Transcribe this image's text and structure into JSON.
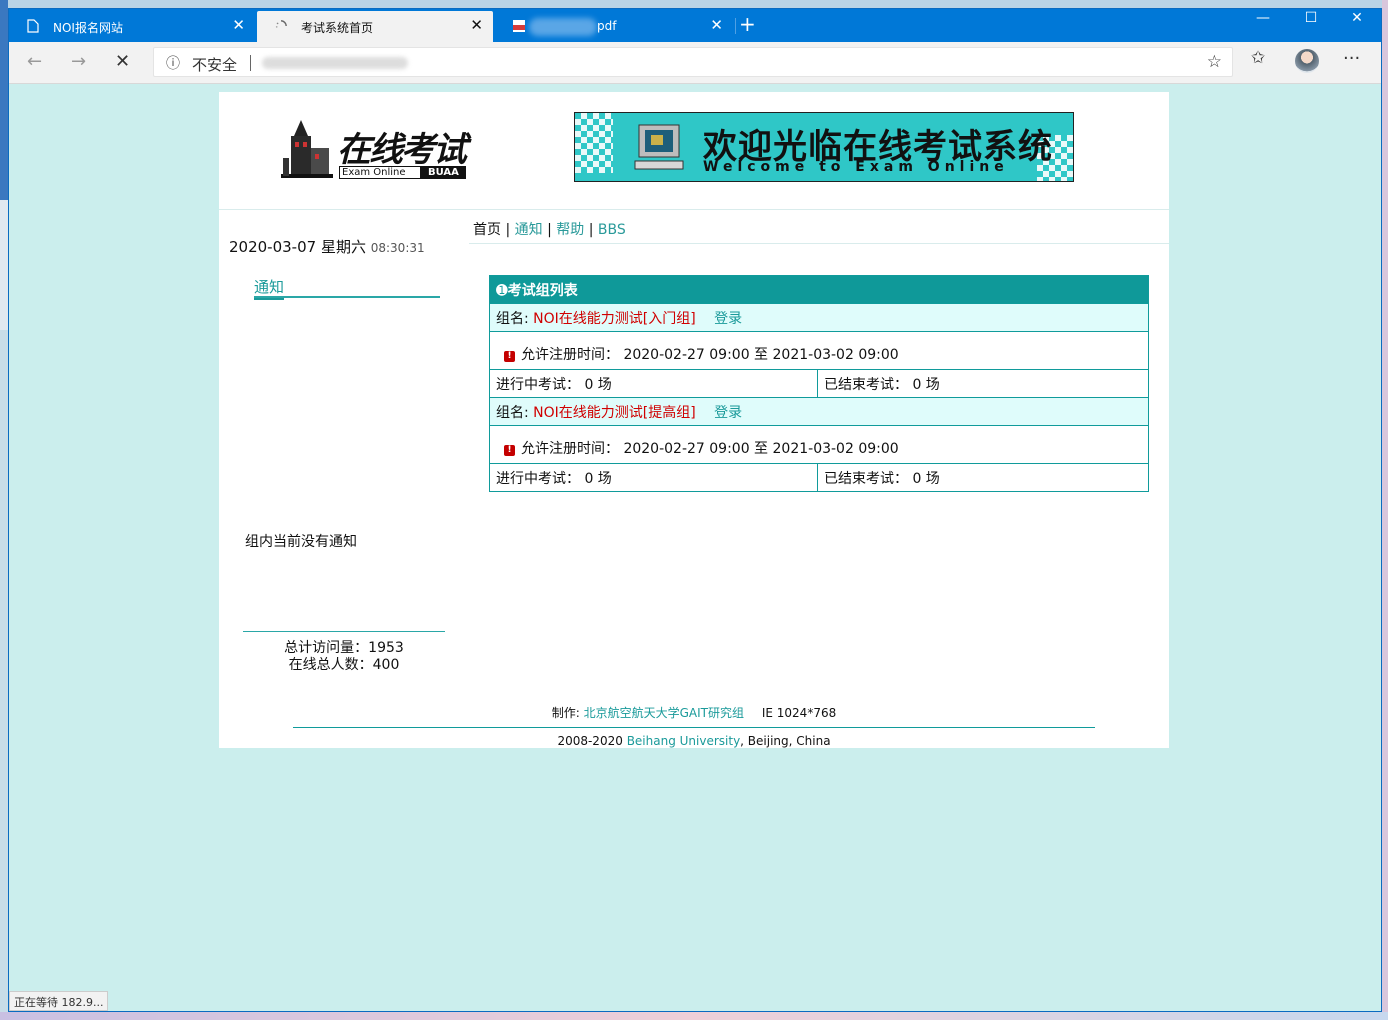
{
  "browser": {
    "tabs": [
      {
        "label": "NOI报名网站",
        "icon": "page-icon"
      },
      {
        "label": "考试系统首页",
        "icon": "loading-spinner-icon"
      },
      {
        "label": "pdf",
        "icon": "pdf-icon"
      }
    ],
    "address": {
      "security": "不安全"
    },
    "status": "正在等待 182.9..."
  },
  "header": {
    "logo_text": "在线考试",
    "logo_sub": "Exam Online",
    "logo_buaa": "BUAA",
    "banner_title": "欢迎光临在线考试系统",
    "banner_sub": "Welcome to Exam Online"
  },
  "left": {
    "date": "2020-03-07 星期六",
    "time": "08:30:31",
    "notice_title": "通知",
    "notice_empty": "组内当前没有通知",
    "visits_label": "总计访问量：1953",
    "online_label": "在线总人数：400"
  },
  "nav": {
    "home": "首页",
    "notice": "通知",
    "help": "帮助",
    "bbs": "BBS"
  },
  "exams": {
    "title": "考试组列表",
    "groups": [
      {
        "name_label": "组名:",
        "name": "NOI在线能力测试[入门组]",
        "login": "登录",
        "reg_time": "允许注册时间： 2020-02-27 09:00 至 2021-03-02 09:00",
        "ongoing": "进行中考试： 0 场",
        "finished": "已结束考试： 0 场"
      },
      {
        "name_label": "组名:",
        "name": "NOI在线能力测试[提高组]",
        "login": "登录",
        "reg_time": "允许注册时间： 2020-02-27 09:00 至 2021-03-02 09:00",
        "ongoing": "进行中考试： 0 场",
        "finished": "已结束考试： 0 场"
      }
    ]
  },
  "footer": {
    "made_by_label": "制作:",
    "made_by": "北京航空航天大学GAIT研究组",
    "ie": "IE 1024*768",
    "copyright_prefix": "2008-2020",
    "university": "Beihang University",
    "copyright_suffix": ", Beijing, China"
  }
}
